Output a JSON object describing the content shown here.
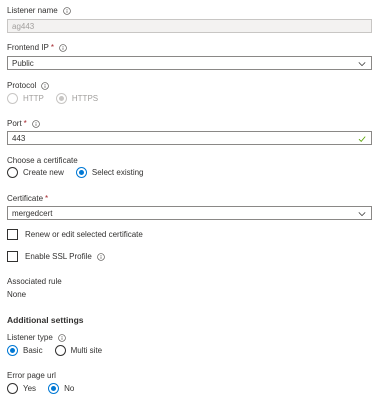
{
  "listener_name": {
    "label": "Listener name",
    "value": "ag443"
  },
  "frontend_ip": {
    "label": "Frontend IP",
    "required": "*",
    "value": "Public"
  },
  "protocol": {
    "label": "Protocol",
    "options": [
      "HTTP",
      "HTTPS"
    ],
    "selected": "HTTPS"
  },
  "port": {
    "label": "Port",
    "required": "*",
    "value": "443"
  },
  "certificate_choice": {
    "label": "Choose a certificate",
    "options": [
      "Create new",
      "Select existing"
    ],
    "selected": "Select existing"
  },
  "certificate": {
    "label": "Certificate",
    "required": "*",
    "value": "mergedcert"
  },
  "renew_checkbox": {
    "label": "Renew or edit selected certificate",
    "checked": false
  },
  "ssl_checkbox": {
    "label": "Enable SSL Profile",
    "checked": false
  },
  "associated_rule": {
    "label": "Associated rule",
    "value": "None"
  },
  "additional_settings": {
    "title": "Additional settings"
  },
  "listener_type": {
    "label": "Listener type",
    "options": [
      "Basic",
      "Multi site"
    ],
    "selected": "Basic"
  },
  "error_page": {
    "label": "Error page url",
    "options": [
      "Yes",
      "No"
    ],
    "selected": "No"
  },
  "colors": {
    "accent": "#0078d4",
    "success": "#57a300",
    "required": "#a4262c"
  }
}
